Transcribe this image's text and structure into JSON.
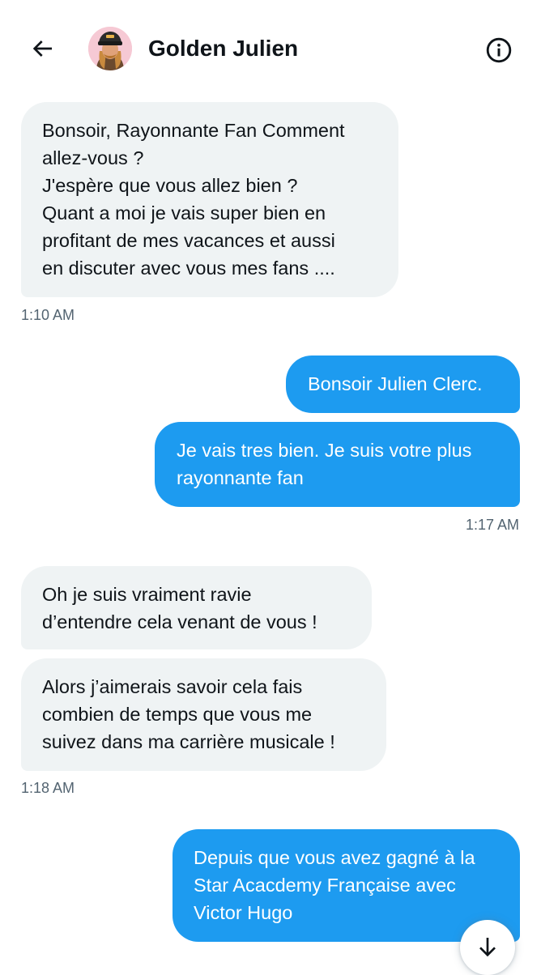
{
  "header": {
    "title": "Golden Julien",
    "back_icon": "arrow-left-icon",
    "info_icon": "info-circle-icon",
    "avatar_icon": "avatar"
  },
  "messages": [
    {
      "direction": "incoming",
      "text": "Bonsoir, Rayonnante Fan Comment\nallez-vous ?\nJ'espère que vous allez bien ?\nQuant a moi je vais super bien en\nprofitant de mes vacances et aussi\nen discuter avec vous mes fans ...."
    },
    {
      "direction": "outgoing",
      "text": "Bonsoir Julien Clerc."
    },
    {
      "direction": "outgoing",
      "text": "Je vais tres bien. Je suis votre plus\nrayonnante fan"
    },
    {
      "direction": "incoming",
      "text": "Oh je suis vraiment ravie\nd’entendre cela venant de vous !"
    },
    {
      "direction": "incoming",
      "text": "Alors j’aimerais savoir cela fais\ncombien de temps que vous me\nsuivez dans ma carrière musicale !"
    },
    {
      "direction": "outgoing",
      "text": "Depuis que vous avez gagné à la\nStar Acacdemy Française avec\nVictor Hugo"
    }
  ],
  "timestamps": [
    "1:10 AM",
    "1:17 AM",
    "1:18 AM"
  ],
  "scroll_button": {
    "icon": "arrow-down-icon"
  },
  "colors": {
    "outgoing_bubble": "#1d9bf0",
    "incoming_bubble": "#eff3f4",
    "timestamp_text": "#536471",
    "primary_text": "#0f1419"
  }
}
